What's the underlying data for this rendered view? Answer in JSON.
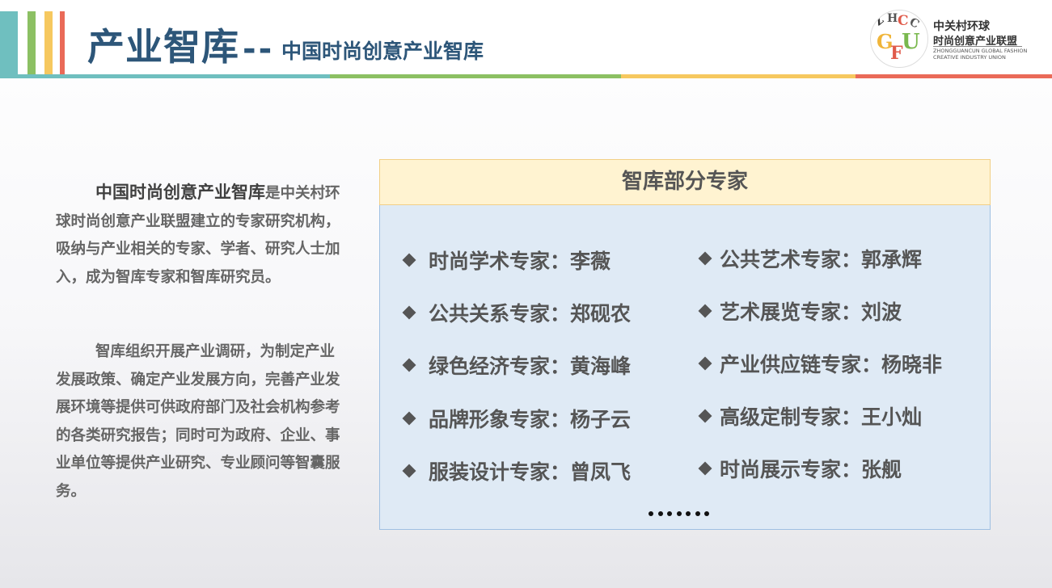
{
  "header": {
    "title_main": "产业智库",
    "title_sep": "--",
    "title_sub": "中国时尚创意产业智库",
    "stripe_colors": [
      "#6fbfbf",
      "#8cc063",
      "#f6c85f",
      "#ea6a58"
    ]
  },
  "logo": {
    "letters": [
      "Z",
      "H",
      "C",
      "G",
      "F",
      "C",
      "U"
    ],
    "name_line1": "中关村环球",
    "name_line2": "时尚创意产业联盟",
    "english_line1": "ZHONGGUANCUN GLOBAL FASHION",
    "english_line2": "CREATIVE INDUSTRY UNION"
  },
  "intro": {
    "highlight": "中国时尚创意产业智库",
    "para1_rest": "是中关村环球时尚创意产业联盟建立的专家研究机构，吸纳与产业相关的专家、学者、研究人士加入，成为智库专家和智库研究员。",
    "para2": "智库组织开展产业调研，为制定产业发展政策、确定产业发展方向，完善产业发展环境等提供可供政府部门及社会机构参考的各类研究报告；同时可为政府、企业、事业单位等提供产业研究、专业顾问等智囊服务。"
  },
  "panel": {
    "title": "智库部分专家",
    "left_experts": [
      "时尚学术专家：李薇",
      "公共关系专家：郑砚农",
      "绿色经济专家：黄海峰",
      "品牌形象专家：杨子云",
      "服装设计专家：曾凤飞"
    ],
    "right_experts": [
      "公共艺术专家：郭承辉",
      "艺术展览专家：刘波",
      "产业供应链专家：杨晓非",
      "高级定制专家：王小灿",
      "时尚展示专家：张舰"
    ],
    "ellipsis_dots": 7
  }
}
